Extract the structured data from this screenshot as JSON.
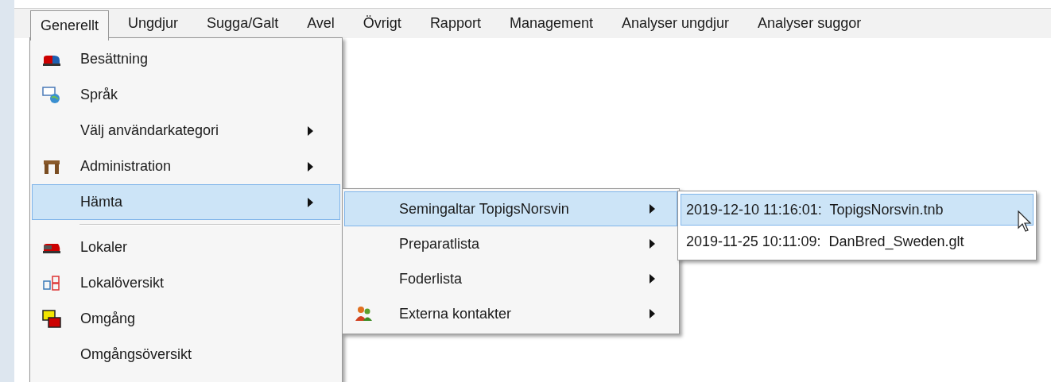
{
  "menubar": [
    {
      "label": "Generellt",
      "selected": true
    },
    {
      "label": "Ungdjur",
      "selected": false
    },
    {
      "label": "Sugga/Galt",
      "selected": false
    },
    {
      "label": "Avel",
      "selected": false
    },
    {
      "label": "Övrigt",
      "selected": false
    },
    {
      "label": "Rapport",
      "selected": false
    },
    {
      "label": "Management",
      "selected": false
    },
    {
      "label": "Analyser ungdjur",
      "selected": false
    },
    {
      "label": "Analyser suggor",
      "selected": false
    }
  ],
  "menu": {
    "items": [
      {
        "kind": "item",
        "label": "Besättning",
        "has_submenu": false,
        "selected": false
      },
      {
        "kind": "item",
        "label": "Språk",
        "has_submenu": false,
        "selected": false
      },
      {
        "kind": "item",
        "label": "Välj användarkategori",
        "has_submenu": true,
        "selected": false
      },
      {
        "kind": "item",
        "label": "Administration",
        "has_submenu": true,
        "selected": false
      },
      {
        "kind": "item",
        "label": "Hämta",
        "has_submenu": true,
        "selected": true
      },
      {
        "kind": "separator"
      },
      {
        "kind": "item",
        "label": "Lokaler",
        "has_submenu": false,
        "selected": false
      },
      {
        "kind": "item",
        "label": "Lokalöversikt",
        "has_submenu": false,
        "selected": false
      },
      {
        "kind": "item",
        "label": "Omgång",
        "has_submenu": false,
        "selected": false
      },
      {
        "kind": "item",
        "label": "Omgångsöversikt",
        "has_submenu": false,
        "selected": false
      }
    ]
  },
  "submenu": {
    "items": [
      {
        "label": "Semingaltar TopigsNorsvin",
        "has_submenu": true,
        "selected": true
      },
      {
        "label": "Preparatlista",
        "has_submenu": true,
        "selected": false
      },
      {
        "label": "Foderlista",
        "has_submenu": true,
        "selected": false
      },
      {
        "label": "Externa kontakter",
        "has_submenu": true,
        "selected": false
      }
    ]
  },
  "file_menu": {
    "items": [
      {
        "label": "2019-12-10 11:16:01:  TopigsNorsvin.tnb",
        "selected": true
      },
      {
        "label": "2019-11-25 10:11:09:  DanBred_Sweden.glt",
        "selected": false
      }
    ]
  }
}
